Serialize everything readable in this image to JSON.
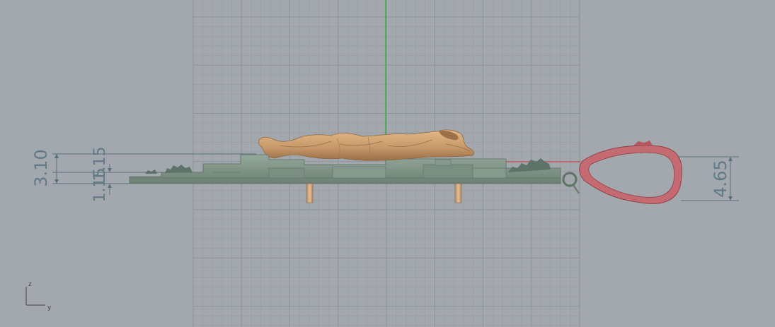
{
  "viewport": {
    "view": "Right",
    "background_color": "#a3a8ae",
    "grid_color": "#979ca2",
    "grid_major_color": "#8d9298",
    "z_axis_color": "#2fae3e",
    "y_axis_color": "#c44b4b"
  },
  "dimensions": {
    "total_height": "3.10",
    "upper_step": "1.15",
    "lower_step": "1.15",
    "bail_height": "4.65"
  },
  "axis_icon": {
    "z_label": "z",
    "y_label": "y"
  },
  "model": {
    "plate_color": "#7d9186",
    "figure_color": "#c99a6b",
    "bail_color": "#cf7277",
    "pin_color": "#c9a07a"
  }
}
